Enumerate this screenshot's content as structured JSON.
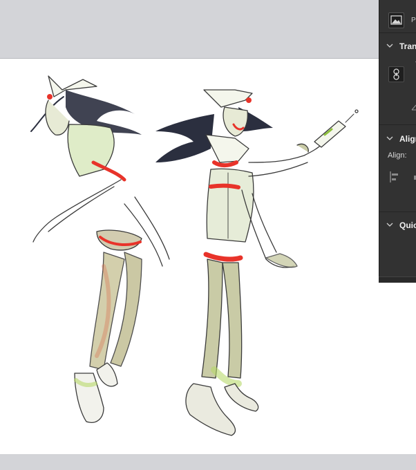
{
  "properties_panel": {
    "pixel_layer_label": "Pi",
    "sections": [
      {
        "title": "Tran"
      },
      {
        "title": "Align"
      },
      {
        "title": "Quic"
      }
    ],
    "align_label": "Align:"
  },
  "colors": {
    "workspace": "#d3d4d8",
    "canvas": "#ffffff",
    "panel": "#323232",
    "panel_text": "#e6e6e6",
    "sketch_line": "#3a3a3a",
    "skin": "#c9cba6",
    "accent_red": "#e8332a",
    "hair": "#2b2f3f"
  },
  "icons": {
    "pixel_layer": "image-icon",
    "link": "link-icon",
    "chevron": "chevron-down-icon",
    "align_left": "align-left-icon",
    "angle": "angle-icon"
  }
}
